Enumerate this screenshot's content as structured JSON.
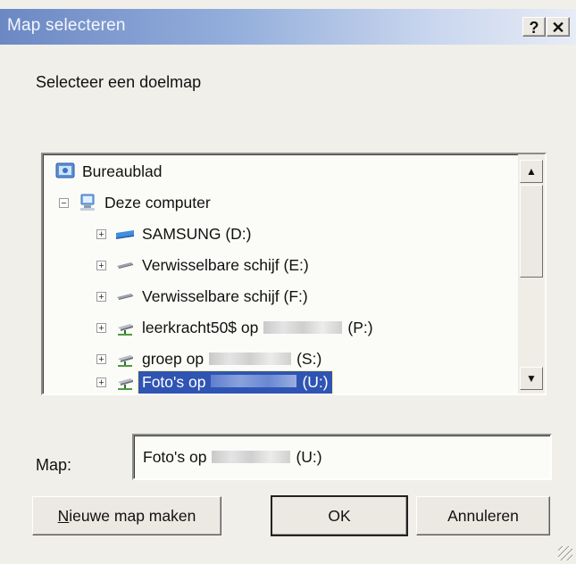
{
  "window": {
    "title": "Map selecteren",
    "help_label": "?",
    "close_label": "✕"
  },
  "instruction": "Selecteer een doelmap",
  "tree": {
    "items": [
      {
        "label": "Bureaublad",
        "suffix": "",
        "icon": "desktop-icon",
        "expander": ""
      },
      {
        "label": "Deze computer",
        "suffix": "",
        "icon": "computer-icon",
        "expander": "−"
      },
      {
        "label": "SAMSUNG (D:)",
        "suffix": "",
        "icon": "drive-icon",
        "expander": "+"
      },
      {
        "label": "Verwisselbare schijf (E:)",
        "suffix": "",
        "icon": "removable-drive-icon",
        "expander": "+"
      },
      {
        "label": "Verwisselbare schijf (F:)",
        "suffix": "",
        "icon": "removable-drive-icon",
        "expander": "+"
      },
      {
        "label": "leerkracht50$ op",
        "suffix": "(P:)",
        "icon": "network-drive-icon",
        "expander": "+"
      },
      {
        "label": "groep op",
        "suffix": "(S:)",
        "icon": "network-drive-icon",
        "expander": "+"
      },
      {
        "label": "Foto's op",
        "suffix": "(U:)",
        "icon": "network-drive-icon",
        "expander": "+"
      }
    ],
    "selected_index": 7
  },
  "map_field": {
    "label": "Map:",
    "value_prefix": "Foto's op",
    "value_suffix": "(U:)"
  },
  "buttons": {
    "new_folder_accel": "N",
    "new_folder_rest": "ieuwe map maken",
    "ok": "OK",
    "cancel": "Annuleren"
  },
  "colors": {
    "selection": "#2f54b3",
    "titlebar_start": "#6c88c4"
  }
}
